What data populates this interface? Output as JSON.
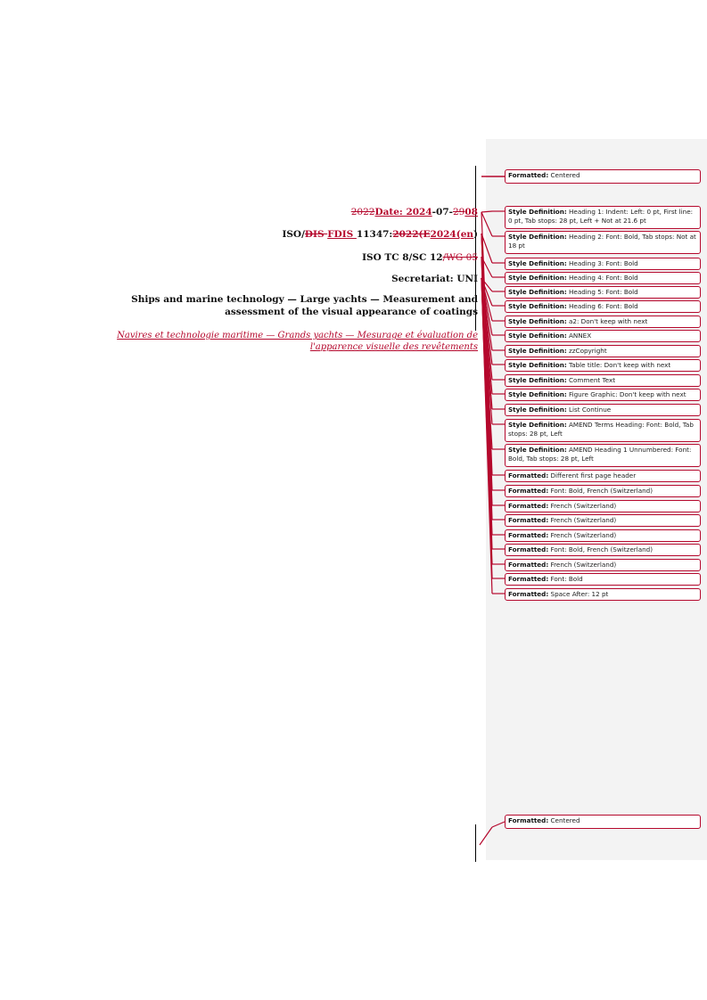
{
  "document": {
    "date_line": [
      {
        "text": "2022",
        "style": "del"
      },
      {
        "text": "Date: 2024",
        "style": "ins"
      },
      {
        "text": "-07-",
        "style": "plain"
      },
      {
        "text": "29",
        "style": "del"
      },
      {
        "text": "08",
        "style": "ins"
      }
    ],
    "iso_line": [
      {
        "text": "ISO/",
        "style": "plain"
      },
      {
        "text": "DIS ",
        "style": "delb"
      },
      {
        "text": "FDIS ",
        "style": "ins"
      },
      {
        "text": "11347:",
        "style": "plain"
      },
      {
        "text": "2022(E",
        "style": "delb"
      },
      {
        "text": "2024(en",
        "style": "ins"
      },
      {
        "text": ")",
        "style": "plain"
      }
    ],
    "committee_line": [
      {
        "text": "ISO TC 8/SC 12",
        "style": "plain"
      },
      {
        "text": "/WG 05",
        "style": "del"
      }
    ],
    "secretariat": "Secretariat: UNI",
    "title_en": "Ships and marine technology — Large yachts — Measurement and assessment of the visual appearance of coatings",
    "title_fr": "Navires et technologie maritime — Grands yachts — Mesurage et évaluation de l'apparence visuelle des revêtements"
  },
  "balloons": [
    {
      "kind": "Formatted:",
      "text": "Centered"
    },
    {
      "kind": "Style Definition:",
      "text": "Heading 1: Indent: Left:  0 pt, First line:  0 pt, Tab stops:  28 pt, Left + Not at  21.6 pt"
    },
    {
      "kind": "Style Definition:",
      "text": "Heading 2: Font: Bold, Tab stops: Not at  18 pt"
    },
    {
      "kind": "Style Definition:",
      "text": "Heading 3: Font: Bold"
    },
    {
      "kind": "Style Definition:",
      "text": "Heading 4: Font: Bold"
    },
    {
      "kind": "Style Definition:",
      "text": "Heading 5: Font: Bold"
    },
    {
      "kind": "Style Definition:",
      "text": "Heading 6: Font: Bold"
    },
    {
      "kind": "Style Definition:",
      "text": "a2: Don't keep with next"
    },
    {
      "kind": "Style Definition:",
      "text": "ANNEX"
    },
    {
      "kind": "Style Definition:",
      "text": "zzCopyright"
    },
    {
      "kind": "Style Definition:",
      "text": "Table title: Don't keep with next"
    },
    {
      "kind": "Style Definition:",
      "text": "Comment Text"
    },
    {
      "kind": "Style Definition:",
      "text": "Figure Graphic: Don't keep with next"
    },
    {
      "kind": "Style Definition:",
      "text": "List Continue"
    },
    {
      "kind": "Style Definition:",
      "text": "AMEND Terms Heading: Font: Bold, Tab stops:  28 pt, Left"
    },
    {
      "kind": "Style Definition:",
      "text": "AMEND Heading 1 Unnumbered: Font: Bold, Tab stops:  28 pt, Left"
    },
    {
      "kind": "Formatted:",
      "text": "Different first page header"
    },
    {
      "kind": "Formatted:",
      "text": "Font: Bold, French (Switzerland)"
    },
    {
      "kind": "Formatted:",
      "text": "French (Switzerland)"
    },
    {
      "kind": "Formatted:",
      "text": "French (Switzerland)"
    },
    {
      "kind": "Formatted:",
      "text": "French (Switzerland)"
    },
    {
      "kind": "Formatted:",
      "text": "Font: Bold, French (Switzerland)"
    },
    {
      "kind": "Formatted:",
      "text": "French (Switzerland)"
    },
    {
      "kind": "Formatted:",
      "text": "Font: Bold"
    },
    {
      "kind": "Formatted:",
      "text": "Space After:  12 pt"
    },
    {
      "kind": "Formatted:",
      "text": "Centered"
    }
  ],
  "colors": {
    "revision": "#b5082d",
    "margin_pane": "#f3f3f3"
  }
}
